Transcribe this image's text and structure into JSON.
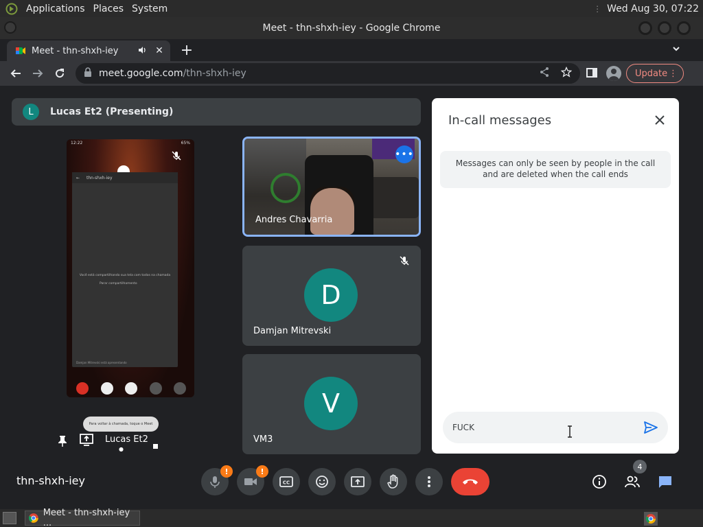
{
  "system": {
    "menus": [
      "Applications",
      "Places",
      "System"
    ],
    "clock": "Wed Aug 30, 07:22"
  },
  "window": {
    "title": "Meet - thn-shxh-iey - Google Chrome"
  },
  "browser": {
    "tab_title": "Meet - thn-shxh-iey",
    "url_host": "meet.google.com",
    "url_path": "/thn-shxh-iey",
    "update_label": "Update"
  },
  "meet": {
    "presenting_initial": "L",
    "presenting_label": "Lucas Et2 (Presenting)",
    "presenter_name": "Lucas Et2",
    "phone": {
      "status_time": "12:22",
      "status_right": "65%",
      "screen_title": "thn-shxh-iey",
      "screen_msg": "Você está compartilhando sua tela com todos na chamada",
      "screen_btn": "Parar compartilhamento",
      "screen_footer": "Damjan Mitrevski está apresentando",
      "toast": "Para voltar à chamada, toque o Meet"
    },
    "participants": [
      {
        "name": "Andres Chavarria",
        "initial": ""
      },
      {
        "name": "Damjan Mitrevski",
        "initial": "D"
      },
      {
        "name": "VM3",
        "initial": "V"
      }
    ],
    "meeting_code": "thn-shxh-iey",
    "people_count": "4",
    "alert_badge": "!"
  },
  "chat": {
    "title": "In-call messages",
    "notice": "Messages can only be seen by people in the call and are deleted when the call ends",
    "input_value": "FUCK"
  },
  "taskbar": {
    "task_label": "Meet - thn-shxh-iey ..."
  },
  "colors": {
    "accent": "#1a73e8",
    "teal": "#12877f",
    "end_call": "#ea4335",
    "badge": "#fa7b17"
  }
}
